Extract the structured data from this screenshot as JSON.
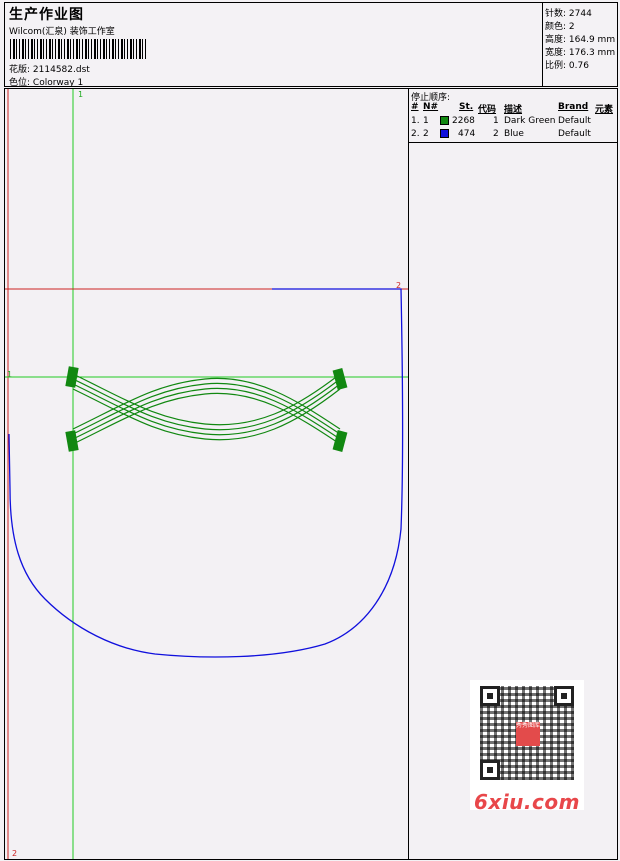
{
  "header": {
    "title": "生产作业图",
    "software": "Wilcom(汇泉) 装饰工作室",
    "design_label": "花版:",
    "design_value": "2114582.dst",
    "colorway_label": "色位:",
    "colorway_value": "Colorway 1"
  },
  "stats": [
    {
      "label": "针数:",
      "value": "2744"
    },
    {
      "label": "颜色:",
      "value": "2"
    },
    {
      "label": "高度:",
      "value": "164.9 mm"
    },
    {
      "label": "宽度:",
      "value": "176.3 mm"
    },
    {
      "label": "比例:",
      "value": "0.76"
    }
  ],
  "stop_sequence": {
    "label": "停止顺序:",
    "columns": [
      "#",
      "N#",
      "St.",
      "代码",
      "描述",
      "Brand",
      "元素"
    ],
    "rows": [
      {
        "num": "1.",
        "n": "1",
        "color": "#118811",
        "stitches": "2268",
        "code": "1",
        "desc": "Dark Green",
        "brand": "Default"
      },
      {
        "num": "2.",
        "n": "2",
        "color": "#1010dd",
        "stitches": "474",
        "code": "2",
        "desc": "Blue",
        "brand": "Default"
      }
    ]
  },
  "guides": {
    "v1": "1",
    "h1": "1",
    "h2": "2",
    "v2": "2"
  },
  "watermark": {
    "text": "6xiu.com",
    "qr_logo": "秀秀图库"
  },
  "colors": {
    "thread_green": "#118811",
    "thread_blue": "#1010dd",
    "guide_green": "#22cc22",
    "guide_red": "#cc2222"
  }
}
